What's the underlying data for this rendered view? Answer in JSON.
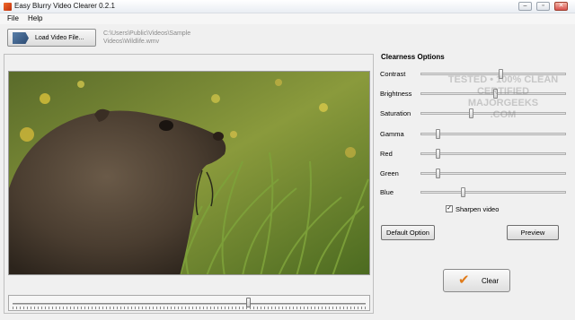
{
  "window": {
    "title": "Easy Blurry Video Clearer 0.2.1",
    "minimize_glyph": "–",
    "maximize_glyph": "▫",
    "close_glyph": "✕"
  },
  "menu": {
    "items": [
      "File",
      "Help"
    ]
  },
  "toolbar": {
    "load_label": "Load Video File...",
    "file_path_line1": "C:\\Users\\Public\\Videos\\Sample",
    "file_path_line2": "Videos\\Wildlife.wmv"
  },
  "playback": {
    "position": 0.67
  },
  "options": {
    "title": "Clearness Options",
    "sliders": [
      {
        "label": "Contrast",
        "value": 0.55
      },
      {
        "label": "Brightness",
        "value": 0.51
      },
      {
        "label": "Saturation",
        "value": 0.34
      },
      {
        "label": "Gamma",
        "value": 0.1
      },
      {
        "label": "Red",
        "value": 0.1
      },
      {
        "label": "Green",
        "value": 0.1
      },
      {
        "label": "Blue",
        "value": 0.28
      }
    ],
    "sharpen": {
      "label": "Sharpen video",
      "checked": true
    },
    "default_label": "Default Option",
    "preview_label": "Preview",
    "clear_label": "Clear"
  },
  "watermark": {
    "line1": "TESTED • 100% CLEAN",
    "line2": "CERTIFIED",
    "line3": "MAJORGEEKS",
    ".com": ".COM"
  },
  "colors": {
    "accent_orange": "#e07b1a",
    "sky_grass": "#6f8a3a"
  }
}
